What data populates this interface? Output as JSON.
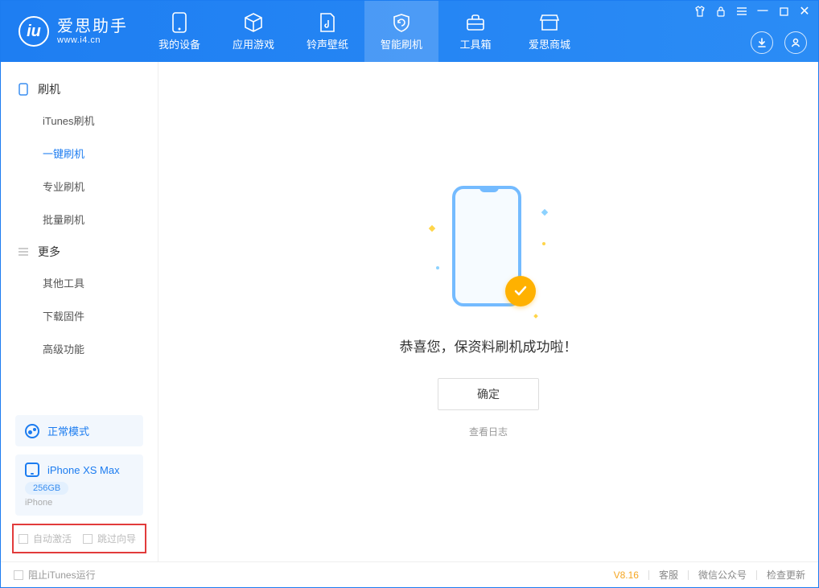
{
  "logo": {
    "title": "爱思助手",
    "url": "www.i4.cn"
  },
  "tabs": [
    {
      "label": "我的设备"
    },
    {
      "label": "应用游戏"
    },
    {
      "label": "铃声壁纸"
    },
    {
      "label": "智能刷机"
    },
    {
      "label": "工具箱"
    },
    {
      "label": "爱思商城"
    }
  ],
  "sidebar": {
    "group1": "刷机",
    "items1": [
      "iTunes刷机",
      "一键刷机",
      "专业刷机",
      "批量刷机"
    ],
    "group2": "更多",
    "items2": [
      "其他工具",
      "下载固件",
      "高级功能"
    ]
  },
  "mode_card": {
    "label": "正常模式"
  },
  "device_card": {
    "name": "iPhone XS Max",
    "storage": "256GB",
    "type": "iPhone"
  },
  "checkboxes": {
    "auto_activate": "自动激活",
    "skip_guide": "跳过向导"
  },
  "main": {
    "success": "恭喜您，保资料刷机成功啦！",
    "ok": "确定",
    "view_log": "查看日志"
  },
  "footer": {
    "block_itunes": "阻止iTunes运行",
    "version": "V8.16",
    "links": [
      "客服",
      "微信公众号",
      "检查更新"
    ]
  }
}
